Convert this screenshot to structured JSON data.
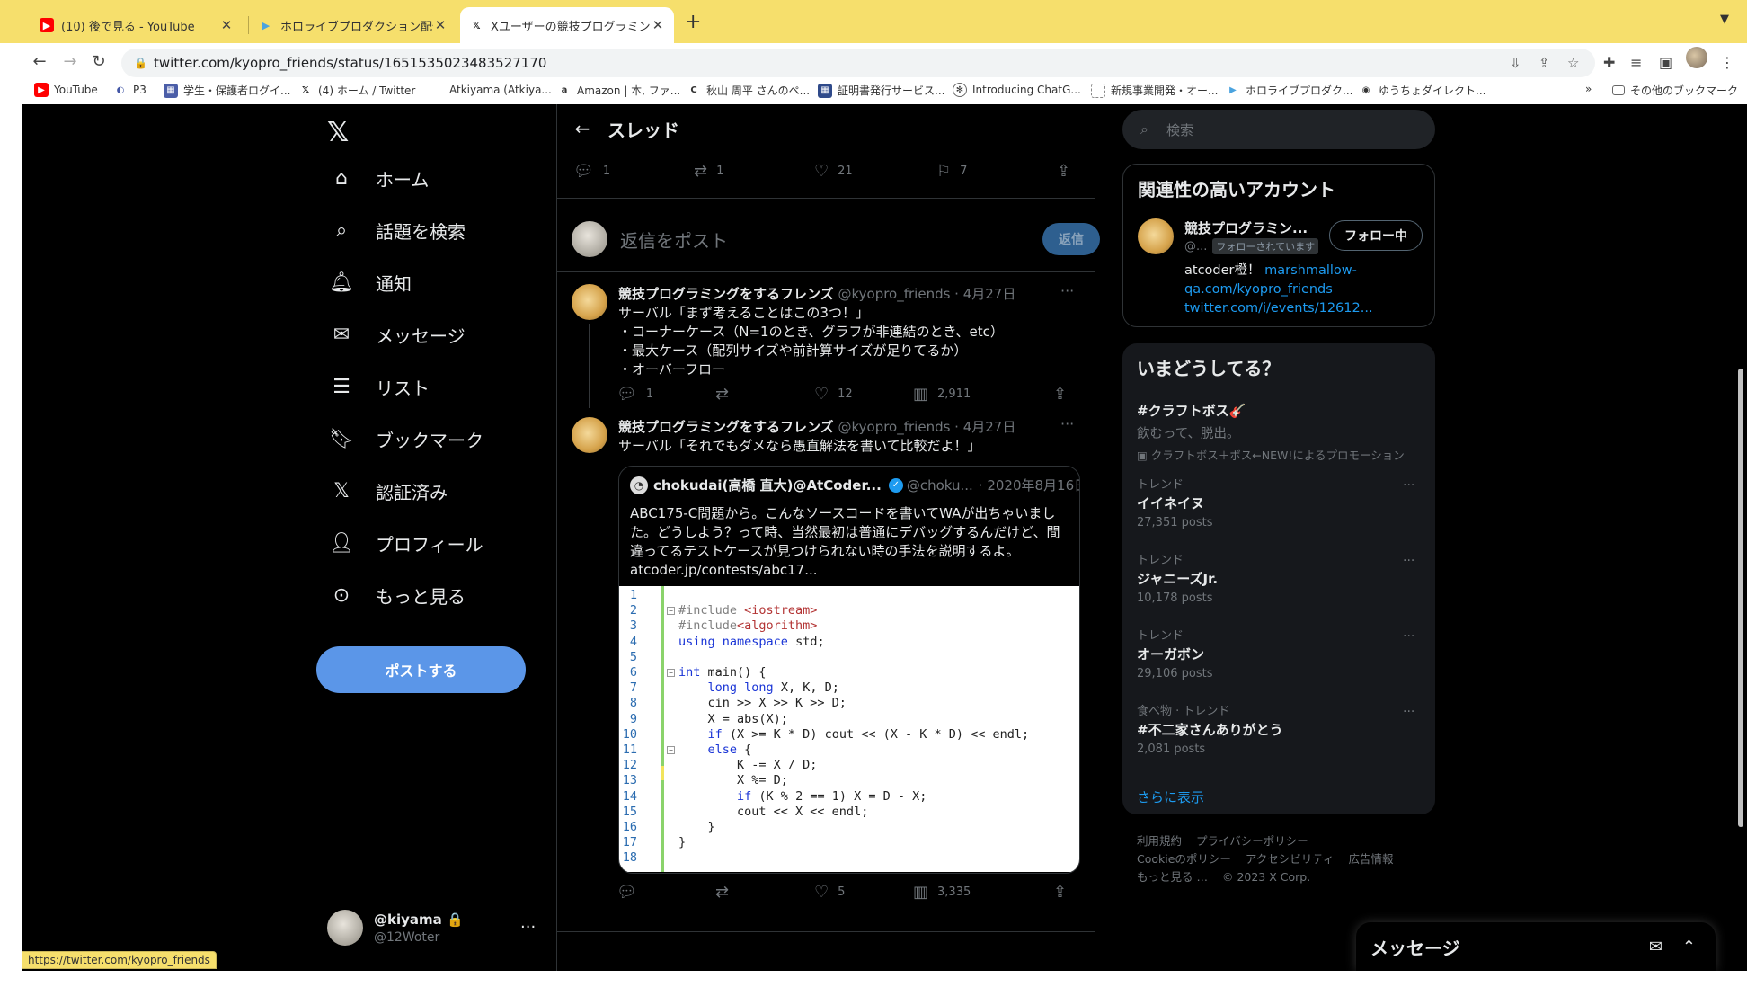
{
  "browser": {
    "tabs": [
      {
        "title": "(10) 後で見る - YouTube",
        "icon": "youtube-icon"
      },
      {
        "title": "ホロライブプロダクション配信予定",
        "icon": "hololive-icon"
      },
      {
        "title": "Xユーザーの競技プログラミング",
        "icon": "x-icon",
        "active": true
      }
    ],
    "url": "twitter.com/kyopro_friends/status/1651535023483527170",
    "bookmarks": [
      {
        "label": "YouTube",
        "icon": "youtube-icon"
      },
      {
        "label": "P3",
        "icon": "p3-icon"
      },
      {
        "label": "学生・保護者ログイ...",
        "icon": "portal-icon"
      },
      {
        "label": "(4) ホーム / Twitter",
        "icon": "x-icon"
      },
      {
        "label": "Atkiyama (Atkiya...",
        "icon": ""
      },
      {
        "label": "Amazon | 本, ファ...",
        "icon": "amazon-icon"
      },
      {
        "label": "秋山 周平 さんのペ...",
        "icon": "c-icon"
      },
      {
        "label": "証明書発行サービス...",
        "icon": "cert-icon"
      },
      {
        "label": "Introducing ChatG...",
        "icon": "openai-icon"
      },
      {
        "label": "新規事業開発・オー...",
        "icon": "doc-icon"
      },
      {
        "label": "ホロライブプロダク...",
        "icon": "hololive-icon"
      },
      {
        "label": "ゆうちょダイレクト...",
        "icon": "globe-icon"
      }
    ],
    "bookmarks_more": "»",
    "other_bookmarks": "その他のブックマーク",
    "status_url": "https://twitter.com/kyopro_friends"
  },
  "nav": {
    "items": [
      {
        "label": "ホーム",
        "icon": "home-icon"
      },
      {
        "label": "話題を検索",
        "icon": "search-icon"
      },
      {
        "label": "通知",
        "icon": "bell-icon"
      },
      {
        "label": "メッセージ",
        "icon": "mail-icon"
      },
      {
        "label": "リスト",
        "icon": "list-icon"
      },
      {
        "label": "ブックマーク",
        "icon": "bookmark-icon"
      },
      {
        "label": "認証済み",
        "icon": "x-icon"
      },
      {
        "label": "プロフィール",
        "icon": "person-icon"
      },
      {
        "label": "もっと見る",
        "icon": "more-circle-icon"
      }
    ],
    "post_button": "ポストする",
    "account": {
      "name": "@kiyama",
      "handle": "@12Woter"
    }
  },
  "thread": {
    "title": "スレッド",
    "main_stats": {
      "replies": "1",
      "reposts": "1",
      "likes": "21",
      "bookmarks": "7"
    },
    "reply_placeholder": "返信をポスト",
    "reply_button": "返信",
    "tweets": [
      {
        "name": "競技プログラミングをするフレンズ",
        "meta": "@kyopro_friends · 4月27日",
        "lines": [
          "サーバル「まず考えることはこの3つ！」",
          "・コーナーケース（N=1のとき、グラフが非連結のとき、etc）",
          "・最大ケース（配列サイズや前計算サイズが足りてるか）",
          "・オーバーフロー"
        ],
        "stats": {
          "replies": "1",
          "reposts": "",
          "likes": "12",
          "views": "2,911"
        }
      },
      {
        "name": "競技プログラミングをするフレンズ",
        "meta": "@kyopro_friends · 4月27日",
        "lines": [
          "サーバル「それでもダメなら愚直解法を書いて比較だよ！」"
        ],
        "stats": {
          "replies": "",
          "reposts": "",
          "likes": "5",
          "views": "3,335"
        },
        "quote": {
          "name": "chokudai(高橋 直大)@AtCoder...",
          "handle": "@choku...",
          "date": "· 2020年8月16日",
          "lines": [
            "ABC175-C問題から。こんなソースコードを書いてWAが出ちゃいまし",
            "た。どうしよう？って時、当然最初は普通にデバッグするんだけど、間",
            "違ってるテストケースが見つけられない時の手法を説明するよ。",
            "atcoder.jp/contests/abc17..."
          ],
          "code_lines": [
            "",
            "#include <iostream>",
            "#include<algorithm>",
            "using namespace std;",
            "",
            "int main() {",
            "    long long X, K, D;",
            "    cin >> X >> K >> D;",
            "    X = abs(X);",
            "    if (X >= K * D) cout << (X - K * D) << endl;",
            "    else {",
            "        K -= X / D;",
            "        X %= D;",
            "        if (K % 2 == 1) X = D - X;",
            "        cout << X << endl;",
            "    }",
            "}",
            ""
          ]
        }
      }
    ]
  },
  "sidebar": {
    "search_placeholder": "検索",
    "who_to_follow": {
      "title": "関連性の高いアカウント",
      "name": "競技プログラミン...",
      "handle": "@...",
      "follows_you": "フォローされています",
      "button": "フォロー中",
      "bio_text": "atcoder橙！",
      "bio_links": [
        "marshmallow-",
        "qa.com/kyopro_friends",
        "twitter.com/i/events/12612..."
      ]
    },
    "trends": {
      "title": "いまどうしてる？",
      "promoted": {
        "name": "#クラフトボス🎸",
        "text": "飲むって、脱出。",
        "by": "クラフトボス＋ボス←NEW!によるプロモーション"
      },
      "items": [
        {
          "category": "トレンド",
          "name": "イイネイヌ",
          "posts": "27,351 posts"
        },
        {
          "category": "トレンド",
          "name": "ジャニーズJr.",
          "posts": "10,178 posts"
        },
        {
          "category": "トレンド",
          "name": "オーガボン",
          "posts": "29,106 posts"
        },
        {
          "category": "食べ物 · トレンド",
          "name": "#不二家さんありがとう",
          "posts": "2,081 posts"
        }
      ],
      "show_more": "さらに表示"
    },
    "footer": [
      "利用規約",
      "プライバシーポリシー",
      "Cookieのポリシー",
      "アクセシビリティ",
      "広告情報",
      "もっと見る …",
      "© 2023 X Corp."
    ]
  },
  "messages_drawer": {
    "title": "メッセージ"
  },
  "colors": {
    "accent": "#1d9bf0",
    "post_button": "#5b96e8",
    "chrome": "#f6df6c",
    "background": "#000000"
  }
}
